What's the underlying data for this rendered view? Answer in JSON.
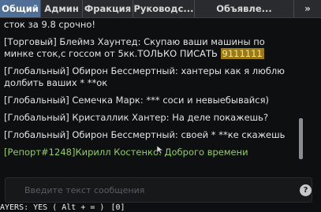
{
  "tabs": [
    {
      "label": "Общий",
      "active": true
    },
    {
      "label": "Админ",
      "active": false
    },
    {
      "label": "Фракция",
      "active": false
    },
    {
      "label": "Руководс...",
      "active": false
    },
    {
      "label": "Объявле...",
      "active": false
    }
  ],
  "tabs_more_label": "»",
  "chat": {
    "messages": [
      {
        "text": "сток за 9.8 срочно!"
      },
      {
        "text": "[Торговый] Блеймз Хаунтед: Скупаю ваши машины по минке сток,с госсом от 5кк.ТОЛЬКО ПИСАТЬ",
        "highlight": "9111111"
      },
      {
        "text": "[Глобальный] Обирон Бессмертный: хантеры как я люблю долбить ваших * **ок"
      },
      {
        "text": "[Глобальный] Семечка Марк: *** соси и невыебывайся)"
      },
      {
        "text": "[Глобальный] Кристаллик Хантер: На деле покажешь?"
      },
      {
        "text": "[Глобальный] Обирон Бессмертный: своей * **ке скажешь"
      },
      {
        "text": "[Репорт#1248]Кирилл Костенко: Доброго времени",
        "report": true
      }
    ]
  },
  "input": {
    "placeholder": "Введите текст сообщения",
    "value": ""
  },
  "help_button_label": "?",
  "status": {
    "layers": "AYERS: YES ( Alt + = )",
    "count": "[0]"
  },
  "colors": {
    "active_tab": "#4f6f96",
    "tab_bar": "#2a2b2e",
    "chat_text": "#e3e3e3",
    "report_text": "#8fd15a",
    "highlight_bg": "#9a7a11"
  },
  "icons": {
    "help": "question-circle-icon",
    "cursor": "mouse-cursor-icon"
  }
}
